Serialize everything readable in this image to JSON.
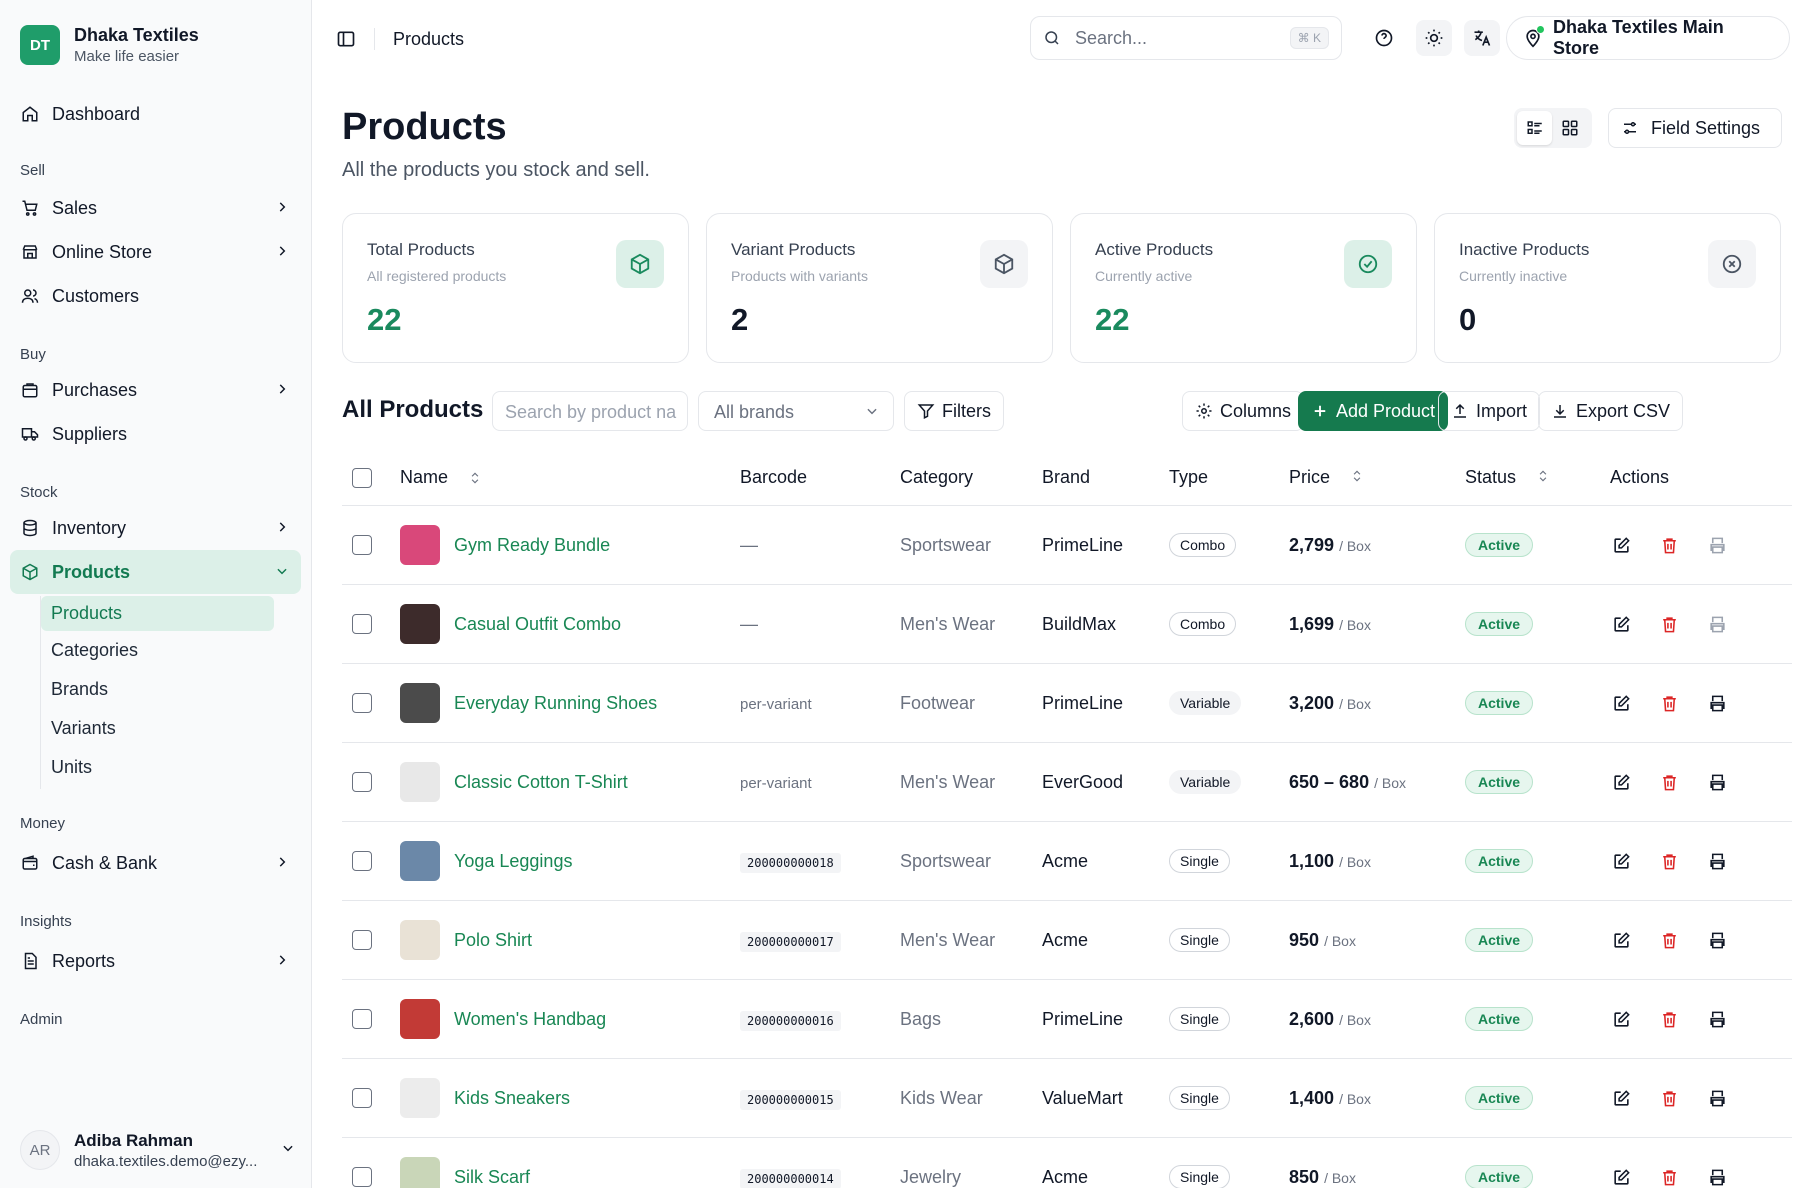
{
  "brand": {
    "initials": "DT",
    "name": "Dhaka Textiles",
    "tagline": "Make life easier"
  },
  "nav": {
    "dashboard": "Dashboard",
    "sell_label": "Sell",
    "sales": "Sales",
    "online_store": "Online Store",
    "customers": "Customers",
    "buy_label": "Buy",
    "purchases": "Purchases",
    "suppliers": "Suppliers",
    "stock_label": "Stock",
    "inventory": "Inventory",
    "products": "Products",
    "sub": [
      "Products",
      "Categories",
      "Brands",
      "Variants",
      "Units"
    ],
    "money_label": "Money",
    "cash_bank": "Cash & Bank",
    "insights_label": "Insights",
    "reports": "Reports",
    "admin_label": "Admin"
  },
  "user": {
    "initials": "AR",
    "name": "Adiba Rahman",
    "email": "dhaka.textiles.demo@ezy..."
  },
  "topbar": {
    "breadcrumb": "Products",
    "search_placeholder": "Search...",
    "shortcut": "⌘ K",
    "store": "Dhaka Textiles Main Store"
  },
  "page": {
    "title": "Products",
    "subtitle": "All the products you stock and sell.",
    "field_settings": "Field Settings"
  },
  "stats": [
    {
      "title": "Total Products",
      "sub": "All registered products",
      "value": "22"
    },
    {
      "title": "Variant Products",
      "sub": "Products with variants",
      "value": "2"
    },
    {
      "title": "Active Products",
      "sub": "Currently active",
      "value": "22"
    },
    {
      "title": "Inactive Products",
      "sub": "Currently inactive",
      "value": "0"
    }
  ],
  "toolbar": {
    "title": "All Products",
    "search_placeholder": "Search by product na",
    "brand_select": "All brands",
    "filters": "Filters",
    "columns": "Columns",
    "add": "Add Product",
    "import": "Import",
    "export": "Export CSV"
  },
  "table": {
    "headers": {
      "name": "Name",
      "barcode": "Barcode",
      "category": "Category",
      "brand": "Brand",
      "type": "Type",
      "price": "Price",
      "status": "Status",
      "actions": "Actions"
    },
    "rows": [
      {
        "name": "Gym Ready Bundle",
        "barcode": "—",
        "category": "Sportswear",
        "brand": "PrimeLine",
        "type": "Combo",
        "price": "2,799",
        "unit": "/ Box",
        "status": "Active",
        "thumb": "#d9487a"
      },
      {
        "name": "Casual Outfit Combo",
        "barcode": "—",
        "category": "Men's Wear",
        "brand": "BuildMax",
        "type": "Combo",
        "price": "1,699",
        "unit": "/ Box",
        "status": "Active",
        "thumb": "#3d2b2b"
      },
      {
        "name": "Everyday Running Shoes",
        "barcode": "per-variant",
        "category": "Footwear",
        "brand": "PrimeLine",
        "type": "Variable",
        "price": "3,200",
        "unit": "/ Box",
        "status": "Active",
        "thumb": "#4b4b4b"
      },
      {
        "name": "Classic Cotton T-Shirt",
        "barcode": "per-variant",
        "category": "Men's Wear",
        "brand": "EverGood",
        "type": "Variable",
        "price": "650 – 680",
        "unit": "/ Box",
        "status": "Active",
        "thumb": "#e8e8e8"
      },
      {
        "name": "Yoga Leggings",
        "barcode": "200000000018",
        "category": "Sportswear",
        "brand": "Acme",
        "type": "Single",
        "price": "1,100",
        "unit": "/ Box",
        "status": "Active",
        "thumb": "#6b88a8"
      },
      {
        "name": "Polo Shirt",
        "barcode": "200000000017",
        "category": "Men's Wear",
        "brand": "Acme",
        "type": "Single",
        "price": "950",
        "unit": "/ Box",
        "status": "Active",
        "thumb": "#e9e2d6"
      },
      {
        "name": "Women's Handbag",
        "barcode": "200000000016",
        "category": "Bags",
        "brand": "PrimeLine",
        "type": "Single",
        "price": "2,600",
        "unit": "/ Box",
        "status": "Active",
        "thumb": "#c23a36"
      },
      {
        "name": "Kids Sneakers",
        "barcode": "200000000015",
        "category": "Kids Wear",
        "brand": "ValueMart",
        "type": "Single",
        "price": "1,400",
        "unit": "/ Box",
        "status": "Active",
        "thumb": "#ececec"
      },
      {
        "name": "Silk Scarf",
        "barcode": "200000000014",
        "category": "Jewelry",
        "brand": "Acme",
        "type": "Single",
        "price": "850",
        "unit": "/ Box",
        "status": "Active",
        "thumb": "#c9d6b8"
      }
    ]
  },
  "colors": {
    "accent": "#157a4e",
    "accent_light": "#dcf0e8",
    "danger": "#dc2626"
  }
}
